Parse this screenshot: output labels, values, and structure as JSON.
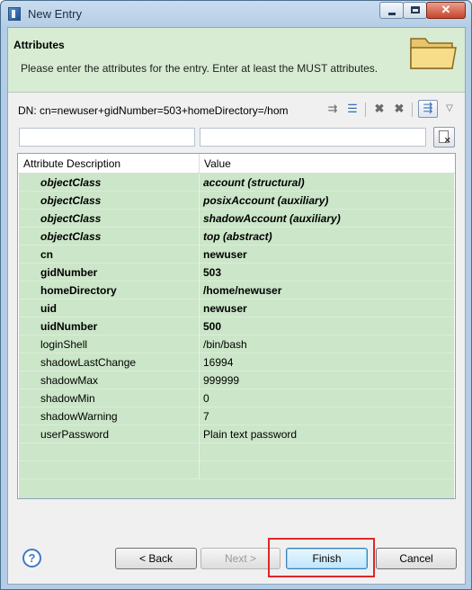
{
  "window": {
    "title": "New Entry"
  },
  "header": {
    "title": "Attributes",
    "description": "Please enter the attributes for the entry. Enter at least the MUST attributes."
  },
  "dn": {
    "text": "DN: cn=newuser+gidNumber=503+homeDirectory=/hom"
  },
  "table": {
    "columns": [
      "Attribute Description",
      "Value"
    ],
    "rows": [
      {
        "attr": "objectClass",
        "value": "account (structural)",
        "style": "objectclass"
      },
      {
        "attr": "objectClass",
        "value": "posixAccount (auxiliary)",
        "style": "objectclass"
      },
      {
        "attr": "objectClass",
        "value": "shadowAccount (auxiliary)",
        "style": "objectclass"
      },
      {
        "attr": "objectClass",
        "value": "top (abstract)",
        "style": "objectclass"
      },
      {
        "attr": "cn",
        "value": "newuser",
        "style": "must"
      },
      {
        "attr": "gidNumber",
        "value": "503",
        "style": "must"
      },
      {
        "attr": "homeDirectory",
        "value": "/home/newuser",
        "style": "must"
      },
      {
        "attr": "uid",
        "value": "newuser",
        "style": "must"
      },
      {
        "attr": "uidNumber",
        "value": "500",
        "style": "must"
      },
      {
        "attr": "loginShell",
        "value": "/bin/bash",
        "style": "may"
      },
      {
        "attr": "shadowLastChange",
        "value": "16994",
        "style": "may"
      },
      {
        "attr": "shadowMax",
        "value": "999999",
        "style": "may"
      },
      {
        "attr": "shadowMin",
        "value": "0",
        "style": "may"
      },
      {
        "attr": "shadowWarning",
        "value": "7",
        "style": "may"
      },
      {
        "attr": "userPassword",
        "value": "Plain text password",
        "style": "may"
      }
    ],
    "row_color": "#cbe6c8"
  },
  "buttons": {
    "back": "< Back",
    "next": "Next >",
    "finish": "Finish",
    "cancel": "Cancel"
  },
  "colors": {
    "highlight": "#e0262a",
    "header_bg": "#d7ecd2"
  },
  "icons": {
    "help": "?",
    "close": "✕",
    "toolbar": [
      "new-attribute-icon",
      "new-value-icon",
      "delete-icon",
      "delete-all-icon",
      "show-decorated-values-icon",
      "menu-arrow-icon"
    ]
  }
}
